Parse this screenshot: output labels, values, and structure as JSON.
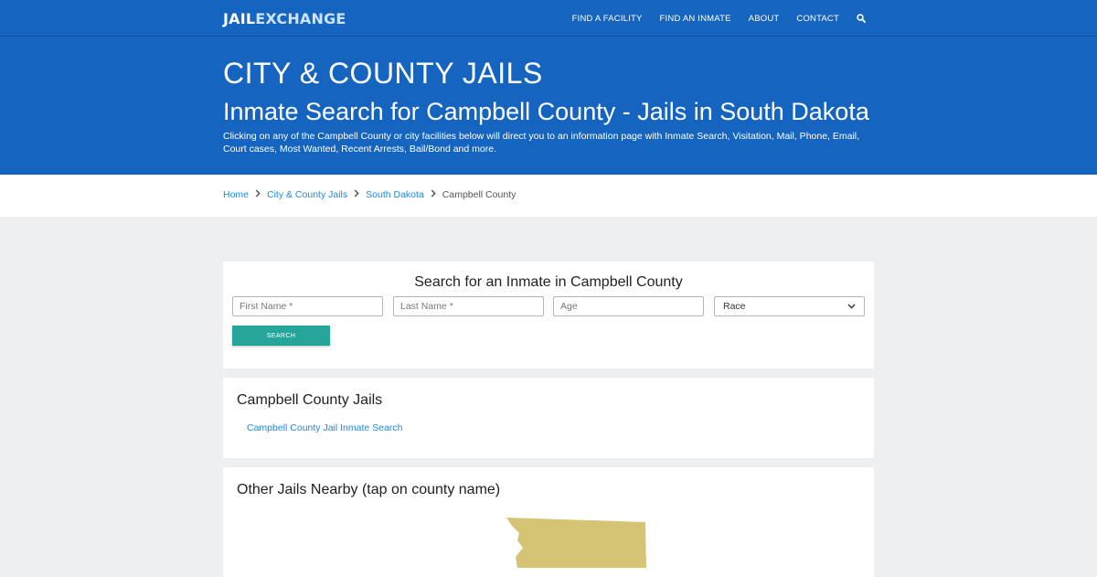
{
  "nav": {
    "logo_left": "JAIL",
    "logo_right": "EXCHANGE",
    "links": [
      "FIND A FACILITY",
      "FIND AN INMATE",
      "ABOUT",
      "CONTACT"
    ],
    "search_icon": "search-icon"
  },
  "hero": {
    "kicker": "CITY & COUNTY JAILS",
    "title": "Inmate Search for Campbell County - Jails in South Dakota",
    "description": "Clicking on any of the Campbell County or city facilities below will direct you to an information page with Inmate Search, Visitation, Mail, Phone, Email, Court cases, Most Wanted, Recent Arrests, Bail/Bond and more."
  },
  "breadcrumb": {
    "items": [
      "Home",
      "City & County Jails",
      "South Dakota"
    ],
    "current": "Campbell County",
    "separator_icon": "chevron-right-icon"
  },
  "search_form": {
    "title": "Search for an Inmate in Campbell County",
    "first_name_placeholder": "First Name *",
    "last_name_placeholder": "Last Name *",
    "age_placeholder": "Age",
    "race_selected": "Race",
    "submit_label": "SEARCH"
  },
  "jails": {
    "heading": "Campbell County Jails",
    "links": [
      "Campbell County Jail Inmate Search"
    ]
  },
  "nearby": {
    "heading": "Other Jails Nearby (tap on county name)",
    "map_color": "#d4c474"
  },
  "colors": {
    "brand": "#1565c0",
    "link": "#1e88e5",
    "button": "#26a69a"
  }
}
